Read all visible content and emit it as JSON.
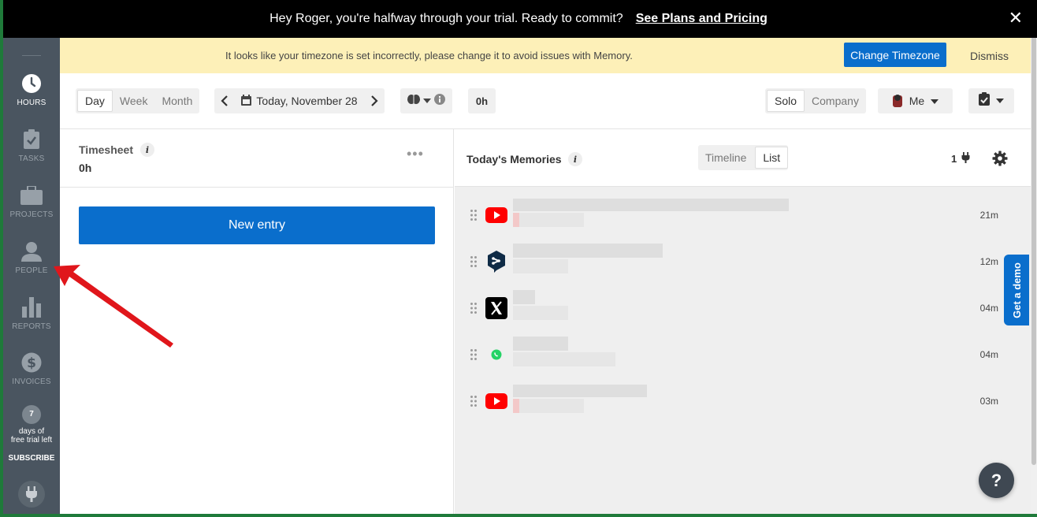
{
  "trial_banner": {
    "message": "Hey Roger, you're halfway through your trial. Ready to commit?",
    "link": "See Plans and Pricing",
    "close": "✕"
  },
  "sidebar": {
    "items": [
      {
        "label": "HOURS",
        "icon": "clock-icon",
        "active": true
      },
      {
        "label": "TASKS",
        "icon": "clipboard-check-icon",
        "active": false
      },
      {
        "label": "PROJECTS",
        "icon": "briefcase-icon",
        "active": false
      },
      {
        "label": "PEOPLE",
        "icon": "person-icon",
        "active": false
      },
      {
        "label": "REPORTS",
        "icon": "bar-chart-icon",
        "active": false
      },
      {
        "label": "INVOICES",
        "icon": "dollar-icon",
        "active": false
      }
    ],
    "trial_days": "7",
    "trial_text_1": "days of",
    "trial_text_2": "free trial left",
    "subscribe": "SUBSCRIBE"
  },
  "timezone_bar": {
    "message": "It looks like your timezone is set incorrectly, please change it to avoid issues with Memory.",
    "button": "Change Timezone",
    "dismiss": "Dismiss"
  },
  "toolbar": {
    "views": [
      "Day",
      "Week",
      "Month"
    ],
    "selected_view": "Day",
    "date": "Today, November 28",
    "hours": "0h",
    "modes": [
      "Solo",
      "Company"
    ],
    "selected_mode": "Solo",
    "user": "Me"
  },
  "timesheet": {
    "title": "Timesheet",
    "hours": "0h",
    "new_entry": "New entry"
  },
  "memories": {
    "title": "Today's Memories",
    "views": [
      "Timeline",
      "List"
    ],
    "selected_view": "List",
    "count": "1",
    "rows": [
      {
        "app": "youtube-icon",
        "duration": "21m"
      },
      {
        "app": "deepl-icon",
        "duration": "12m"
      },
      {
        "app": "x-twitter-icon",
        "duration": "04m"
      },
      {
        "app": "whatsapp-icon",
        "duration": "04m"
      },
      {
        "app": "youtube-icon",
        "duration": "03m"
      }
    ]
  },
  "demo_tab": "Get a demo",
  "help": "?",
  "colors": {
    "primary": "#0a6ecc",
    "sidebar": "#4a5560",
    "banner": "#000000",
    "timezone_bar": "#fdf0b8",
    "annotation_arrow": "#e0161b"
  }
}
